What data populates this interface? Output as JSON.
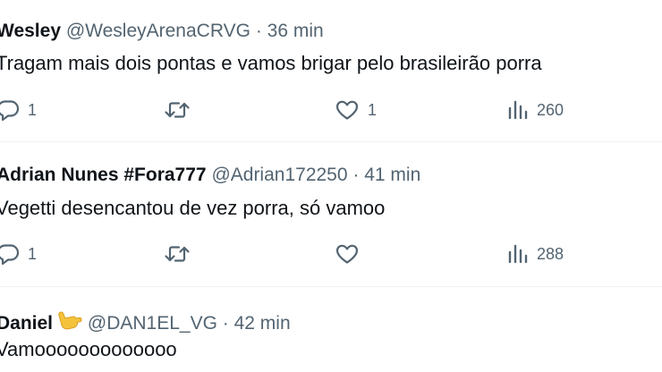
{
  "tweets": [
    {
      "name": "Wesley",
      "handle": "@WesleyArenaCRVG",
      "separator": "·",
      "time": "36 min",
      "text": "Tragam mais dois pontas e vamos brigar pelo brasileirão porra",
      "replies": "1",
      "retweets": "",
      "likes": "1",
      "views": "260"
    },
    {
      "name": "Adrian Nunes #Fora777",
      "handle": "@Adrian172250",
      "separator": "·",
      "time": "41 min",
      "text": "Vegetti desencantou de vez porra, só vamoo",
      "replies": "1",
      "retweets": "",
      "likes": "",
      "views": "288"
    },
    {
      "name": "Daniel",
      "handle": "@DAN1EL_VG",
      "separator": "·",
      "time": "42 min",
      "text": "Vamooooooooooooo"
    }
  ],
  "icons": {
    "reply": "reply-icon",
    "retweet": "retweet-icon",
    "like": "heart-icon",
    "views": "views-icon",
    "emoji": "call-me-hand-emoji"
  },
  "colors": {
    "text": "#0f1419",
    "secondary": "#536471",
    "divider": "#eff3f4",
    "emoji": "#f5c33b"
  }
}
